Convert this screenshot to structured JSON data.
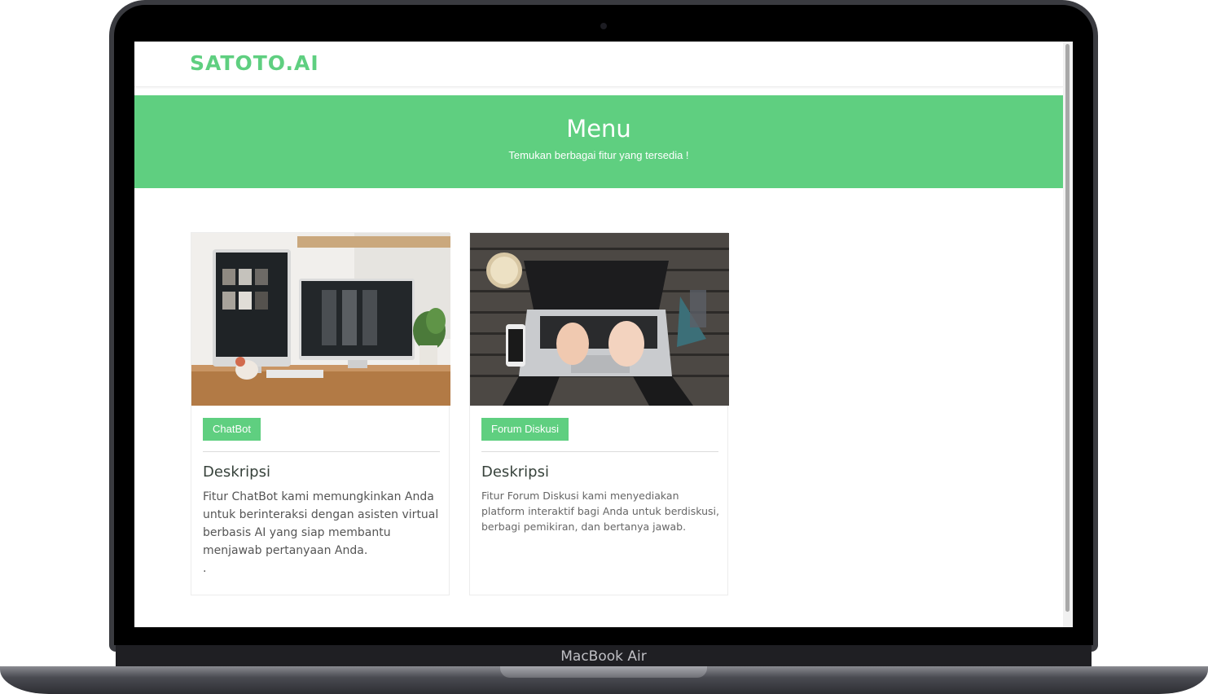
{
  "device": {
    "label": "MacBook Air"
  },
  "navbar": {
    "logo": "SATOTO.AI"
  },
  "hero": {
    "title": "Menu",
    "subtitle": "Temukan berbagai fitur yang tersedia !"
  },
  "cards": [
    {
      "badge": "ChatBot",
      "title": "Deskripsi",
      "text": "Fitur ChatBot kami memungkinkan Anda untuk berinteraksi dengan asisten virtual berbasis AI yang siap membantu menjawab pertanyaan Anda.",
      "extra": "."
    },
    {
      "badge": "Forum Diskusi",
      "title": "Deskripsi",
      "text": "Fitur Forum Diskusi kami menyediakan platform interaktif bagi Anda untuk berdiskusi, berbagi pemikiran, dan bertanya jawab."
    }
  ],
  "colors": {
    "accent": "#5fcf80",
    "text_dark": "#37423b"
  }
}
